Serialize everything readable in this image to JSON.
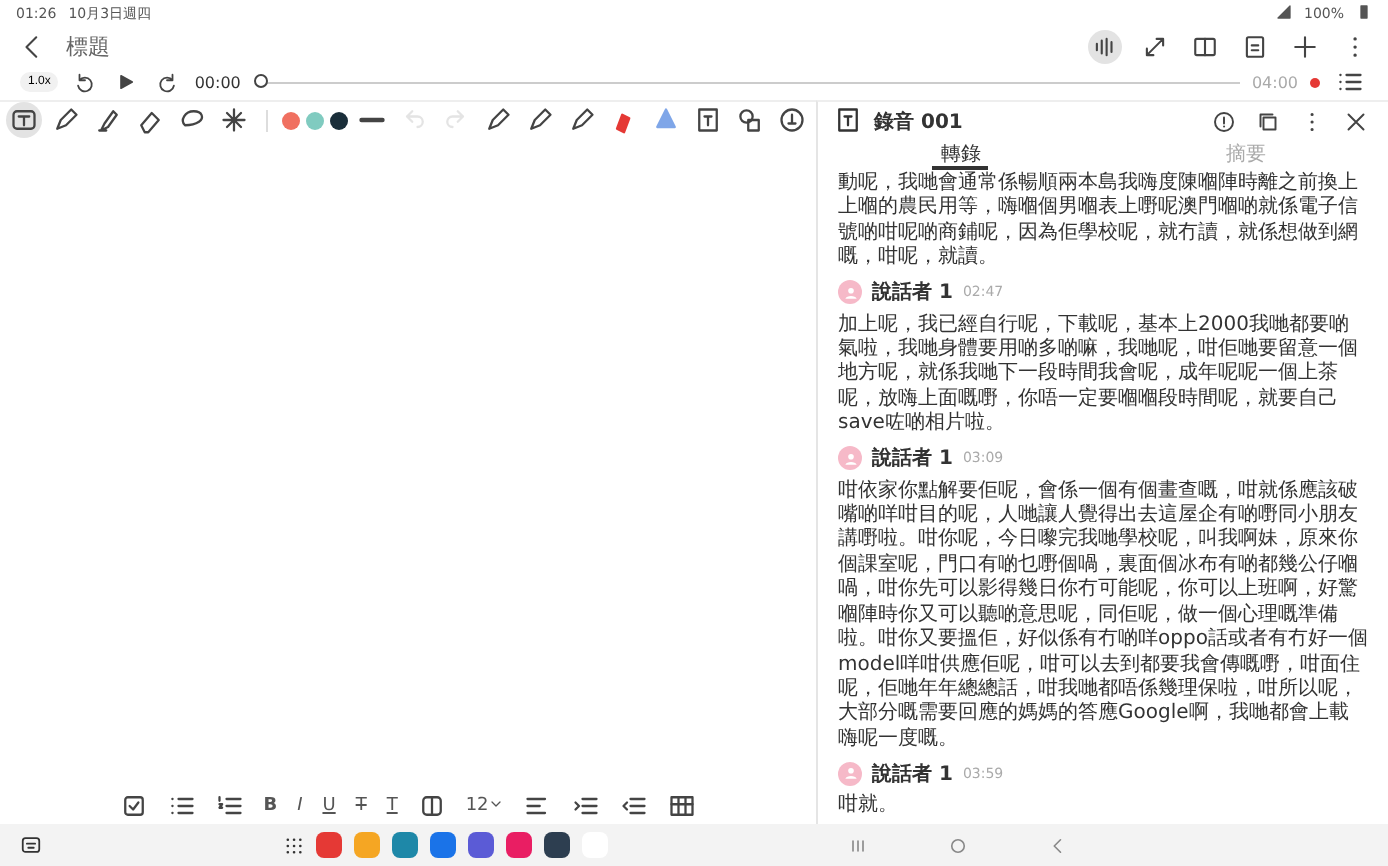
{
  "status_bar": {
    "time": "01:26",
    "date": "10月3日週四",
    "battery": "100%"
  },
  "header": {
    "title": "標題"
  },
  "player": {
    "speed": "1.0x",
    "elapsed": "00:00",
    "total": "04:00",
    "level": 0
  },
  "drawing_toolbar": {
    "tools": [
      {
        "kind": "text-box",
        "selected": true
      },
      {
        "kind": "pen",
        "selected": false
      },
      {
        "kind": "highlighter",
        "selected": false
      },
      {
        "kind": "eraser",
        "selected": false
      },
      {
        "kind": "lasso",
        "selected": false
      },
      {
        "kind": "sparkle",
        "selected": false
      }
    ],
    "colors": [
      {
        "color": "#f07060"
      },
      {
        "color": "#80cbc0"
      },
      {
        "color": "#1a2e3a"
      }
    ],
    "actions": [
      {
        "kind": "line",
        "disabled": false
      },
      {
        "kind": "undo",
        "disabled": true
      },
      {
        "kind": "redo",
        "disabled": true
      },
      {
        "kind": "pen",
        "disabled": false
      },
      {
        "kind": "pen",
        "disabled": false
      },
      {
        "kind": "pen",
        "disabled": false
      },
      {
        "kind": "marker",
        "disabled": false
      },
      {
        "kind": "fill",
        "disabled": false
      },
      {
        "kind": "text-insert",
        "disabled": false
      },
      {
        "kind": "shapes",
        "disabled": false
      },
      {
        "kind": "stamp",
        "disabled": false
      }
    ]
  },
  "transcript_panel": {
    "title": "錄音 001",
    "tabs": [
      {
        "label": "轉錄",
        "selected": true
      },
      {
        "label": "摘要",
        "selected": false
      }
    ],
    "segments": [
      {
        "text": "動呢，我哋會通常係暢順兩本島我嗨度陳嗰陣時離之前換上上嗰的農民用等，嗨嗰個男嗰表上嘢呢澳門嗰啲就係電子信號啲咁呢啲商鋪呢，因為佢學校呢，就冇讀，就係想做到網嘅，咁呢，就讀。"
      },
      {
        "speaker": "說話者 1",
        "time": "02:47",
        "text": "加上呢，我已經自行呢，下載呢，基本上2000我哋都要啲氣啦，我哋身體要用啲多啲嘛，我哋呢，咁佢哋要留意一個地方呢，就係我哋下一段時間我會呢，成年呢呢一個上茶呢，放嗨上面嘅嘢，你唔一定要嗰嗰段時間呢，就要自己save咗啲相片啦。"
      },
      {
        "speaker": "說話者 1",
        "time": "03:09",
        "text": "咁依家你點解要佢呢，會係一個有個畫查嘅，咁就係應該破嘴啲咩咁目的呢，人哋讓人覺得出去這屋企有啲嘢同小朋友講嘢啦。咁你呢，今日嚟完我哋學校呢，叫我啊妹，原來你個課室呢，門口有啲乜嘢個喎，裏面個冰布有啲都幾公仔嗰喎，咁你先可以影得幾日你冇可能呢，你可以上班啊，好驚嗰陣時你又可以聽啲意思呢，同佢呢，做一個心理嘅準備啦。咁你又要搵佢，好似係有冇啲咩oppo話或者有冇好一個model咩咁供應佢呢，咁可以去到都要我會傳嘅嘢，咁面住呢，佢哋年年總總話，咁我哋都唔係幾理保啦，咁所以呢，大部分嘅需要回應的媽媽的答應Google啊，我哋都會上載嗨呢一度嘅。"
      },
      {
        "speaker": "說話者 1",
        "time": "03:59",
        "text": "咁就。"
      }
    ]
  },
  "format_toolbar": [
    {
      "kind": "checkbox"
    },
    {
      "kind": "bullet-list"
    },
    {
      "kind": "numbered-list"
    },
    {
      "kind": "bold",
      "label": "B"
    },
    {
      "kind": "italic",
      "label": "I"
    },
    {
      "kind": "underline",
      "label": "U"
    },
    {
      "kind": "strike",
      "label": "T"
    },
    {
      "kind": "text-color",
      "label": "T"
    },
    {
      "kind": "highlight"
    },
    {
      "kind": "font-size",
      "label": "12"
    },
    {
      "kind": "align"
    },
    {
      "kind": "indent"
    },
    {
      "kind": "outdent"
    },
    {
      "kind": "table"
    }
  ],
  "nav_bar": {
    "apps": [
      {
        "color": "#e53935"
      },
      {
        "color": "#f5a623"
      },
      {
        "color": "#1e88a8"
      },
      {
        "color": "#1a73e8"
      },
      {
        "color": "#5b5bd6"
      },
      {
        "color": "#e91e63"
      },
      {
        "color": "#2d3e50"
      },
      {
        "color": "#ffffff"
      }
    ]
  }
}
